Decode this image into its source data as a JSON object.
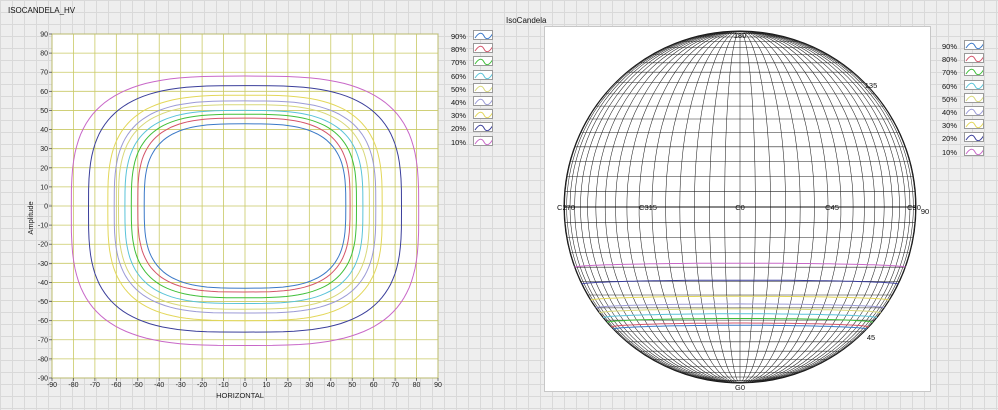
{
  "panel_left": {
    "title": "ISOCANDELA_HV"
  },
  "panel_right": {
    "title": "IsoCandela"
  },
  "legend_items": [
    {
      "label": "90%",
      "color": "#3a78c7"
    },
    {
      "label": "80%",
      "color": "#d4546a"
    },
    {
      "label": "70%",
      "color": "#3fbf3a"
    },
    {
      "label": "60%",
      "color": "#59c3d9"
    },
    {
      "label": "50%",
      "color": "#d8d87a"
    },
    {
      "label": "40%",
      "color": "#9b9ad6"
    },
    {
      "label": "30%",
      "color": "#e3d75a"
    },
    {
      "label": "20%",
      "color": "#3a3e9a"
    },
    {
      "label": "10%",
      "color": "#c868c8"
    }
  ],
  "chart_data": [
    {
      "type": "line",
      "title": "ISOCANDELA_HV",
      "xlabel": "HORIZONTAL",
      "ylabel": "Amplitude",
      "xlim": [
        -90,
        90
      ],
      "ylim": [
        -90,
        90
      ],
      "xticks": [
        -90,
        -80,
        -70,
        -60,
        -50,
        -40,
        -30,
        -20,
        -10,
        0,
        10,
        20,
        30,
        40,
        50,
        60,
        70,
        80,
        90
      ],
      "yticks": [
        90,
        80,
        70,
        60,
        50,
        40,
        30,
        20,
        10,
        0,
        -10,
        -20,
        -30,
        -40,
        -50,
        -60,
        -70,
        -80,
        -90
      ],
      "grid": true,
      "legend_position": "right",
      "series": [
        {
          "name": "90%",
          "color": "#3a78c7",
          "x_left": -47,
          "x_right": 47,
          "y_top": 43,
          "y_bottom": -43
        },
        {
          "name": "80%",
          "color": "#d4546a",
          "x_left": -50,
          "x_right": 49,
          "y_top": 46,
          "y_bottom": -45
        },
        {
          "name": "70%",
          "color": "#3fbf3a",
          "x_left": -53,
          "x_right": 52,
          "y_top": 48,
          "y_bottom": -48
        },
        {
          "name": "60%",
          "color": "#59c3d9",
          "x_left": -56,
          "x_right": 55,
          "y_top": 50,
          "y_bottom": -51
        },
        {
          "name": "50%",
          "color": "#d8d87a",
          "x_left": -59,
          "x_right": 58,
          "y_top": 53,
          "y_bottom": -54
        },
        {
          "name": "40%",
          "color": "#9b9ad6",
          "x_left": -61,
          "x_right": 61,
          "y_top": 55,
          "y_bottom": -56
        },
        {
          "name": "30%",
          "color": "#e3d75a",
          "x_left": -64,
          "x_right": 64,
          "y_top": 58,
          "y_bottom": -60
        },
        {
          "name": "20%",
          "color": "#3a3e9a",
          "x_left": -73,
          "x_right": 73,
          "y_top": 63,
          "y_bottom": -66
        },
        {
          "name": "10%",
          "color": "#c868c8",
          "x_left": -81,
          "x_right": 81,
          "y_top": 68,
          "y_bottom": -73
        }
      ]
    },
    {
      "type": "line",
      "title": "IsoCandela",
      "angle_labels": [
        "180",
        "135",
        "C270",
        "C315",
        "C0",
        "C45",
        "C90",
        "90",
        "45",
        "G0"
      ],
      "grid": true,
      "legend_position": "right",
      "series": [
        {
          "name": "90%",
          "color": "#3a78c7",
          "gamma": 46
        },
        {
          "name": "80%",
          "color": "#d4546a",
          "gamma": 47
        },
        {
          "name": "70%",
          "color": "#3fbf3a",
          "gamma": 49
        },
        {
          "name": "60%",
          "color": "#59c3d9",
          "gamma": 51
        },
        {
          "name": "50%",
          "color": "#d8d87a",
          "gamma": 53
        },
        {
          "name": "40%",
          "color": "#9b9ad6",
          "gamma": 55
        },
        {
          "name": "30%",
          "color": "#e3d75a",
          "gamma": 58
        },
        {
          "name": "20%",
          "color": "#3a3e9a",
          "gamma": 64
        },
        {
          "name": "10%",
          "color": "#c868c8",
          "gamma": 70
        }
      ]
    }
  ]
}
